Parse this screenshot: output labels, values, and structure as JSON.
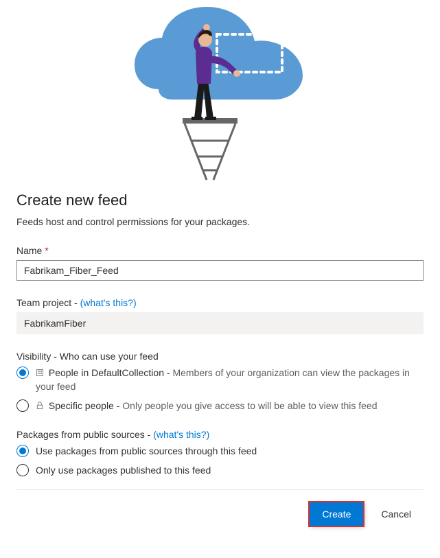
{
  "dialog": {
    "title": "Create new feed",
    "subtitle": "Feeds host and control permissions for your packages."
  },
  "name": {
    "label": "Name",
    "required_marker": "*",
    "value": "Fabrikam_Fiber_Feed"
  },
  "team_project": {
    "label": "Team project - ",
    "help_link": "(what's this?)",
    "value": "FabrikamFiber"
  },
  "visibility": {
    "label": "Visibility - Who can use your feed",
    "options": [
      {
        "icon": "organization-icon",
        "label": "People in DefaultCollection - ",
        "description": "Members of your organization can view the packages in your feed",
        "checked": true
      },
      {
        "icon": "lock-icon",
        "label": "Specific people - ",
        "description": "Only people you give access to will be able to view this feed",
        "checked": false
      }
    ]
  },
  "public_sources": {
    "label": "Packages from public sources - ",
    "help_link": "(what's this?)",
    "options": [
      {
        "label": "Use packages from public sources through this feed",
        "checked": true
      },
      {
        "label": "Only use packages published to this feed",
        "checked": false
      }
    ]
  },
  "actions": {
    "create": "Create",
    "cancel": "Cancel"
  }
}
